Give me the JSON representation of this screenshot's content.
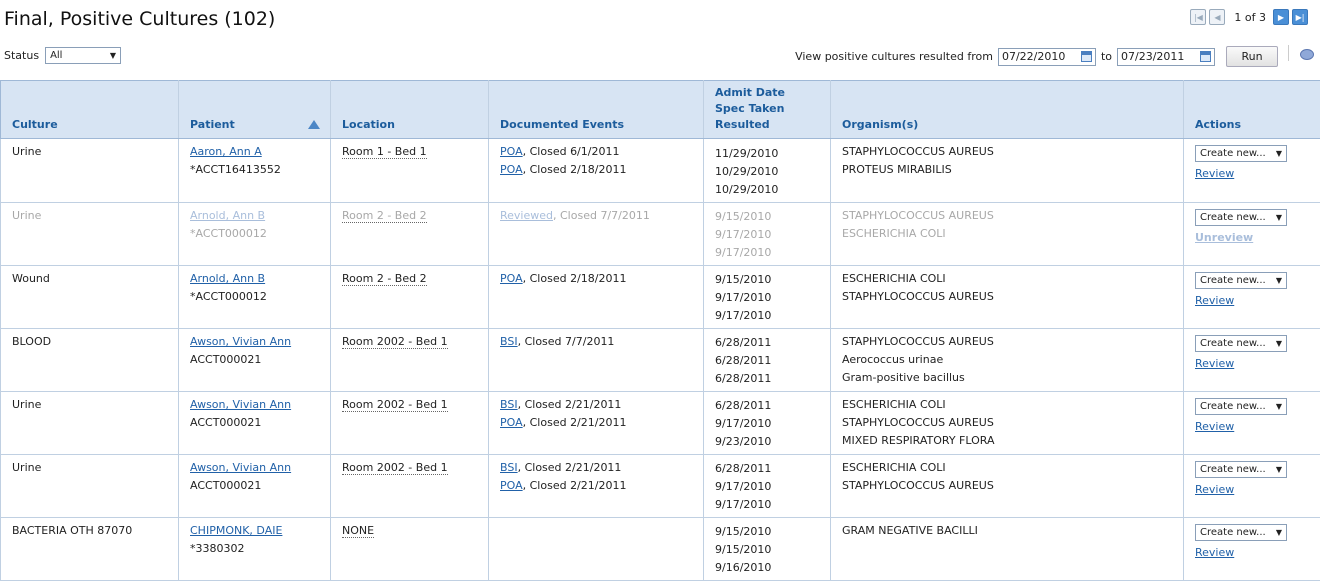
{
  "page": {
    "title": "Final, Positive Cultures (102)"
  },
  "pager": {
    "text": "1 of 3"
  },
  "filters": {
    "status_label": "Status",
    "status_value": "All",
    "range_label": "View positive cultures resulted from",
    "from_date": "07/22/2010",
    "to_label": "to",
    "to_date": "07/23/2011",
    "run_label": "Run"
  },
  "columns": {
    "culture": "Culture",
    "patient": "Patient",
    "location": "Location",
    "events": "Documented Events",
    "dates": [
      "Admit Date",
      "Spec Taken",
      "Resulted"
    ],
    "organisms": "Organism(s)",
    "actions": "Actions"
  },
  "actions": {
    "create_label": "Create new..."
  },
  "rows": [
    {
      "culture": "Urine",
      "patient_name": "Aaron, Ann A",
      "patient_acct": "*ACCT16413552",
      "location": "Room 1 - Bed 1",
      "events": [
        {
          "link": "POA",
          "text": ", Closed 6/1/2011"
        },
        {
          "link": "POA",
          "text": ", Closed 2/18/2011"
        }
      ],
      "dates": [
        "11/29/2010",
        "10/29/2010",
        "10/29/2010"
      ],
      "organisms": [
        "STAPHYLOCOCCUS AUREUS",
        "PROTEUS MIRABILIS"
      ],
      "action_link": "Review"
    },
    {
      "culture": "Urine",
      "patient_name": "Arnold, Ann B",
      "patient_acct": "*ACCT000012",
      "location": "Room 2 - Bed 2",
      "events": [
        {
          "link": "Reviewed",
          "text": ", Closed 7/7/2011"
        }
      ],
      "dates": [
        "9/15/2010",
        "9/17/2010",
        "9/17/2010"
      ],
      "organisms": [
        "STAPHYLOCOCCUS AUREUS",
        "ESCHERICHIA COLI"
      ],
      "action_link": "Unreview"
    },
    {
      "culture": "Wound",
      "patient_name": "Arnold, Ann B",
      "patient_acct": "*ACCT000012",
      "location": "Room 2 - Bed 2",
      "events": [
        {
          "link": "POA",
          "text": ", Closed 2/18/2011"
        }
      ],
      "dates": [
        "9/15/2010",
        "9/17/2010",
        "9/17/2010"
      ],
      "organisms": [
        "ESCHERICHIA COLI",
        "STAPHYLOCOCCUS AUREUS"
      ],
      "action_link": "Review"
    },
    {
      "culture": "BLOOD",
      "patient_name": "Awson, Vivian Ann",
      "patient_acct": "ACCT000021",
      "location": "Room 2002 - Bed 1",
      "events": [
        {
          "link": "BSI",
          "text": ", Closed 7/7/2011"
        }
      ],
      "dates": [
        "6/28/2011",
        "6/28/2011",
        "6/28/2011"
      ],
      "organisms": [
        "STAPHYLOCOCCUS AUREUS",
        "Aerococcus urinae",
        "Gram-positive bacillus"
      ],
      "action_link": "Review"
    },
    {
      "culture": "Urine",
      "patient_name": "Awson, Vivian Ann",
      "patient_acct": "ACCT000021",
      "location": "Room 2002 - Bed 1",
      "events": [
        {
          "link": "BSI",
          "text": ", Closed 2/21/2011"
        },
        {
          "link": "POA",
          "text": ", Closed 2/21/2011"
        }
      ],
      "dates": [
        "6/28/2011",
        "9/17/2010",
        "9/23/2010"
      ],
      "organisms": [
        "ESCHERICHIA COLI",
        "STAPHYLOCOCCUS AUREUS",
        "MIXED RESPIRATORY FLORA"
      ],
      "action_link": "Review"
    },
    {
      "culture": "Urine",
      "patient_name": "Awson, Vivian Ann",
      "patient_acct": "ACCT000021",
      "location": "Room 2002 - Bed 1",
      "events": [
        {
          "link": "BSI",
          "text": ", Closed 2/21/2011"
        },
        {
          "link": "POA",
          "text": ", Closed 2/21/2011"
        }
      ],
      "dates": [
        "6/28/2011",
        "9/17/2010",
        "9/17/2010"
      ],
      "organisms": [
        "ESCHERICHIA COLI",
        "STAPHYLOCOCCUS AUREUS"
      ],
      "action_link": "Review"
    },
    {
      "culture": "BACTERIA OTH 87070",
      "patient_name": "CHIPMONK, DAIE",
      "patient_acct": "*3380302",
      "location": "NONE",
      "events": [],
      "dates": [
        "9/15/2010",
        "9/15/2010",
        "9/16/2010"
      ],
      "organisms": [
        "GRAM NEGATIVE BACILLI"
      ],
      "action_link": "Review"
    }
  ]
}
